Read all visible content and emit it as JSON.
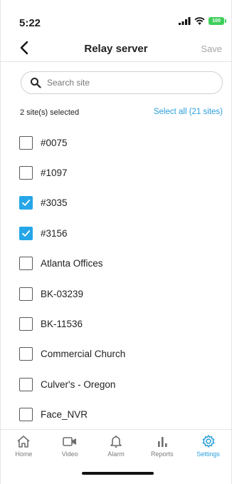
{
  "status_bar": {
    "time": "5:22",
    "battery": "100"
  },
  "nav": {
    "title": "Relay server",
    "save_label": "Save"
  },
  "search": {
    "placeholder": "Search site",
    "value": ""
  },
  "selection": {
    "count_text": "2 site(s) selected",
    "select_all_label": "Select all (21 sites)"
  },
  "sites": [
    {
      "label": "#0075",
      "checked": false
    },
    {
      "label": "#1097",
      "checked": false
    },
    {
      "label": "#3035",
      "checked": true
    },
    {
      "label": "#3156",
      "checked": true
    },
    {
      "label": "Atlanta Offices",
      "checked": false
    },
    {
      "label": "BK-03239",
      "checked": false
    },
    {
      "label": "BK-11536",
      "checked": false
    },
    {
      "label": "Commercial Church",
      "checked": false
    },
    {
      "label": "Culver's - Oregon",
      "checked": false
    },
    {
      "label": "Face_NVR",
      "checked": false
    }
  ],
  "tabs": [
    {
      "label": "Home",
      "icon": "home-icon",
      "active": false
    },
    {
      "label": "Video",
      "icon": "video-icon",
      "active": false
    },
    {
      "label": "Alarm",
      "icon": "bell-icon",
      "active": false
    },
    {
      "label": "Reports",
      "icon": "bar-chart-icon",
      "active": false
    },
    {
      "label": "Settings",
      "icon": "gear-icon",
      "active": true
    }
  ],
  "colors": {
    "accent": "#2b9fdc",
    "checkbox_checked": "#26a6e8",
    "battery": "#3ecf5a",
    "disabled_text": "#a6a6a6"
  }
}
